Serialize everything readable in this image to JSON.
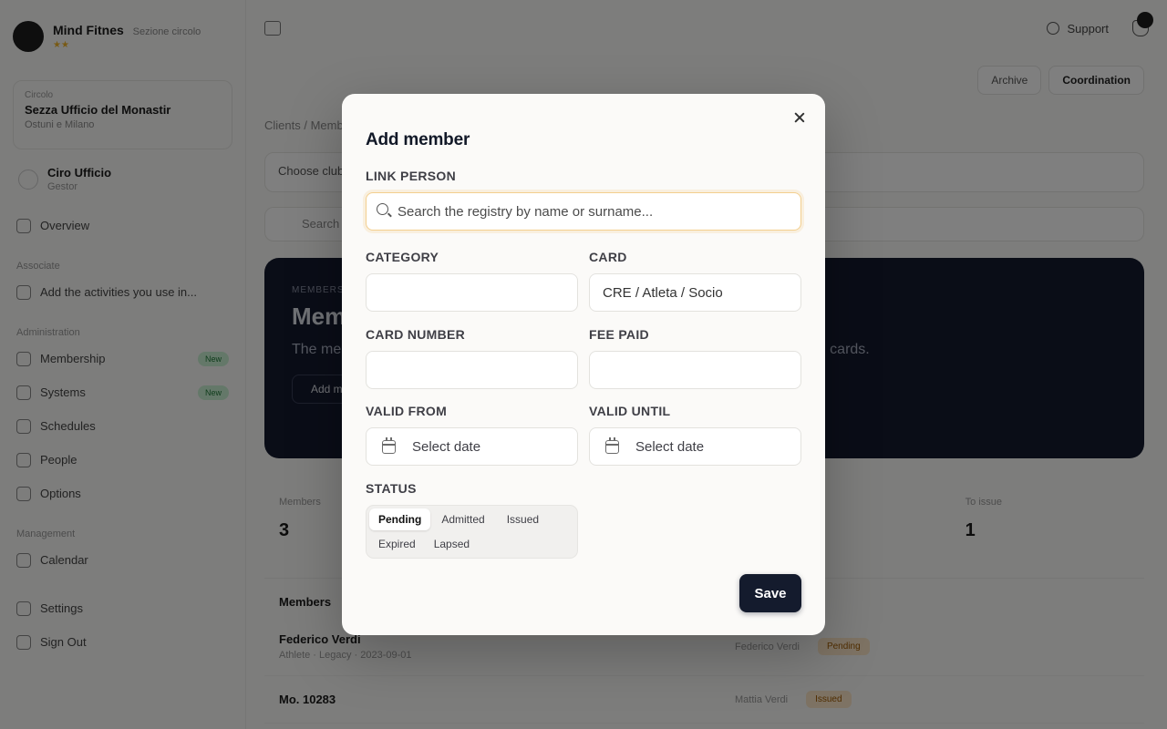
{
  "background": {
    "sidebar": {
      "brand_name": "Mind Fitnes",
      "brand_sub": "Sezione circolo",
      "club_label": "Circolo",
      "club_name": "Sezza Ufficio del Monastir",
      "club_location": "Ostuni e Milano",
      "user_name": "Ciro Ufficio",
      "user_role": "Gestor",
      "nav_overview": "Overview",
      "section_associate": "Associate",
      "nav_search": "Add the activities you use in...",
      "section_administration": "Administration",
      "nav_membership": "Membership",
      "nav_membership_pill": "New",
      "nav_systems": "Systems",
      "nav_systems_pill": "New",
      "nav_schedules": "Schedules",
      "nav_people": "People",
      "nav_options": "Options",
      "section_management": "Management",
      "nav_calendar": "Calendar",
      "nav_settings": "Settings",
      "nav_signout": "Sign Out"
    },
    "topbar": {
      "support_label": "Support"
    },
    "main": {
      "action_archive": "Archive",
      "action_coordination": "Coordination",
      "breadcrumb": "Clients / Members",
      "select_placeholder": "Choose club",
      "search_placeholder": "Search members",
      "hero_kicker": "MEMBERSHIP",
      "hero_title": "Members",
      "hero_text": "The member registry and their status. The renewals state is derived from all issued cards.",
      "hero_button": "Add member",
      "stat_members_label": "Members",
      "stat_members_value": "3",
      "stat_to_issue_label": "To issue",
      "stat_to_issue_value": "1",
      "list_title": "Members",
      "rows": [
        {
          "name": "Federico Verdi",
          "sub": "Athlete · Legacy · 2023-09-01",
          "owner": "Federico Verdi",
          "badge": "Pending"
        },
        {
          "name": "Mo. 10283",
          "sub": "",
          "owner": "Mattia Verdi",
          "badge": "Issued"
        }
      ]
    }
  },
  "modal": {
    "title": "Add member",
    "link_person_label": "LINK PERSON",
    "search_placeholder": "Search the registry by name or surname...",
    "category_label": "CATEGORY",
    "category_value": "",
    "card_label": "CARD",
    "card_value": "CRE / Atleta / Socio",
    "card_number_label": "CARD NUMBER",
    "card_number_value": "",
    "fee_paid_label": "FEE PAID",
    "fee_paid_value": "",
    "valid_from_label": "VALID FROM",
    "valid_from_value": "Select date",
    "valid_until_label": "VALID UNTIL",
    "valid_until_value": "Select date",
    "status_label": "STATUS",
    "status_options": [
      "Pending",
      "Admitted",
      "Issued",
      "Expired",
      "Lapsed"
    ],
    "status_selected": "Pending",
    "save_label": "Save"
  },
  "colors": {
    "primary_button": "#141b2d",
    "focus_ring": "#f3cf8e",
    "hero_background": "#141a2e"
  },
  "icons": {
    "close": "close-icon",
    "search": "search-icon",
    "date": "calendar-icon"
  }
}
